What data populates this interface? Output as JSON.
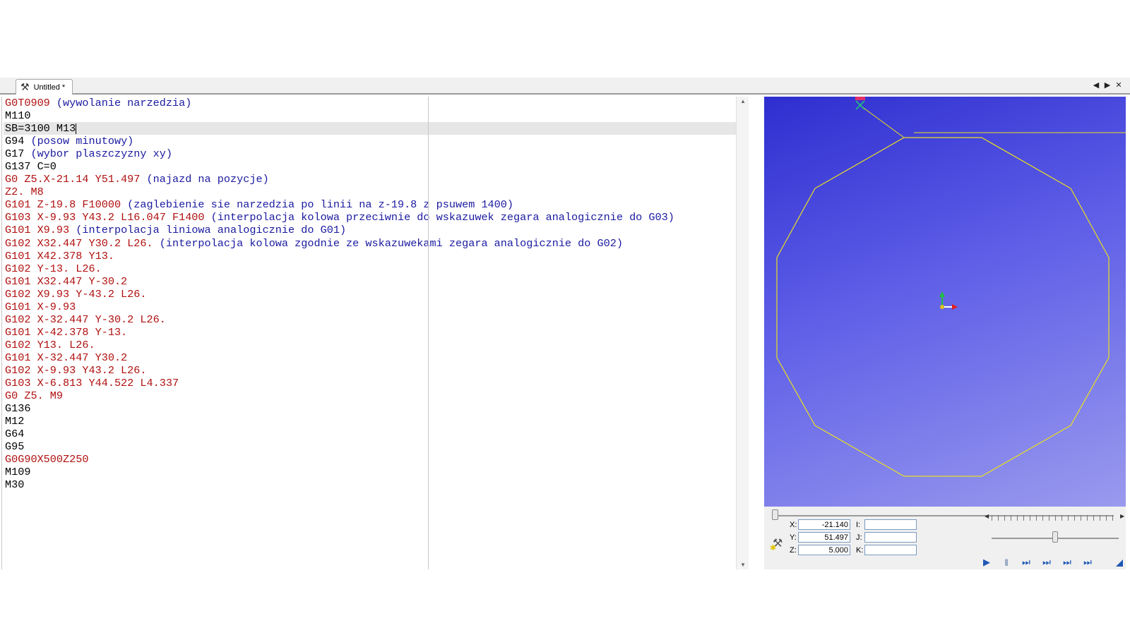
{
  "tab": {
    "title": "Untitled *",
    "icon": "tool-icon"
  },
  "tab_controls": [
    {
      "name": "prev-tab-icon",
      "glyph": "◀"
    },
    {
      "name": "next-tab-icon",
      "glyph": "▶"
    },
    {
      "name": "close-icon",
      "glyph": "✕"
    }
  ],
  "editor": {
    "lines": [
      {
        "cmd": "G0T0909 ",
        "cmt": "(wywolanie narzedzia)",
        "color": "red"
      },
      {
        "cmd": "M110",
        "cmt": "",
        "color": "black"
      },
      {
        "cmd": "SB=3100 M13",
        "cmt": "",
        "color": "black",
        "current": true
      },
      {
        "cmd": "G94 ",
        "cmt": "(posow minutowy)",
        "color": "black"
      },
      {
        "cmd": "G17 ",
        "cmt": "(wybor plaszczyzny xy)",
        "color": "black"
      },
      {
        "cmd": "G137 C=0",
        "cmt": "",
        "color": "black"
      },
      {
        "cmd": "G0 Z5.X-21.14 Y51.497 ",
        "cmt": "(najazd na pozycje)",
        "color": "red"
      },
      {
        "cmd": "Z2. M8",
        "cmt": "",
        "color": "red"
      },
      {
        "cmd": "G101 Z-19.8 F10000 ",
        "cmt": "(zaglebienie sie narzedzia po linii na z-19.8 z psuwem 1400)",
        "color": "red"
      },
      {
        "cmd": "G103 X-9.93 Y43.2 L16.047 F1400 ",
        "cmt": "(interpolacja kolowa przeciwnie do wskazuwek zegara analogicznie do G03)",
        "color": "red"
      },
      {
        "cmd": "G101 X9.93 ",
        "cmt": "(interpolacja liniowa analogicznie do G01)",
        "color": "red"
      },
      {
        "cmd": "G102 X32.447 Y30.2 L26. ",
        "cmt": "(interpolacja kolowa zgodnie ze wskazuwekami zegara analogicznie do G02)",
        "color": "red"
      },
      {
        "cmd": "G101 X42.378 Y13.",
        "cmt": "",
        "color": "red"
      },
      {
        "cmd": "G102 Y-13. L26.",
        "cmt": "",
        "color": "red"
      },
      {
        "cmd": "G101 X32.447 Y-30.2",
        "cmt": "",
        "color": "red"
      },
      {
        "cmd": "G102 X9.93 Y-43.2 L26.",
        "cmt": "",
        "color": "red"
      },
      {
        "cmd": "G101 X-9.93",
        "cmt": "",
        "color": "red"
      },
      {
        "cmd": "G102 X-32.447 Y-30.2 L26.",
        "cmt": "",
        "color": "red"
      },
      {
        "cmd": "G101 X-42.378 Y-13.",
        "cmt": "",
        "color": "red"
      },
      {
        "cmd": "G102 Y13. L26.",
        "cmt": "",
        "color": "red"
      },
      {
        "cmd": "G101 X-32.447 Y30.2",
        "cmt": "",
        "color": "red"
      },
      {
        "cmd": "G102 X-9.93 Y43.2 L26.",
        "cmt": "",
        "color": "red"
      },
      {
        "cmd": "G103 X-6.813 Y44.522 L4.337",
        "cmt": "",
        "color": "red"
      },
      {
        "cmd": "G0 Z5. M9",
        "cmt": "",
        "color": "red"
      },
      {
        "cmd": "G136",
        "cmt": "",
        "color": "black"
      },
      {
        "cmd": "M12",
        "cmt": "",
        "color": "black"
      },
      {
        "cmd": "G64",
        "cmt": "",
        "color": "black"
      },
      {
        "cmd": "G95",
        "cmt": "",
        "color": "black"
      },
      {
        "cmd": "G0G90X500Z250",
        "cmt": "",
        "color": "red"
      },
      {
        "cmd": "M109",
        "cmt": "",
        "color": "black"
      },
      {
        "cmd": "M30",
        "cmt": "",
        "color": "black"
      }
    ]
  },
  "coords": {
    "x_label": "X:",
    "x_value": "-21.140",
    "y_label": "Y:",
    "y_value": "51.497",
    "z_label": "Z:",
    "z_value": "5.000",
    "i_label": "I:",
    "i_value": "",
    "j_label": "J:",
    "j_value": "",
    "k_label": "K:",
    "k_value": ""
  },
  "simulation": {
    "progress": 0,
    "speed_fraction": 0.5,
    "buttons": [
      {
        "name": "play-button",
        "glyph": "▶"
      },
      {
        "name": "pause-button",
        "glyph": "‖"
      },
      {
        "name": "step-button",
        "glyph": "⏭"
      },
      {
        "name": "step-xy-button",
        "glyph": "⏭"
      },
      {
        "name": "step-z-button",
        "glyph": "⏭"
      },
      {
        "name": "step-tool-button",
        "glyph": "⏭"
      }
    ]
  },
  "colors": {
    "code_red": "#b01010",
    "comment_blue": "#1a1aa0",
    "toolpath_yellow": "#e8e020",
    "viewport_top": "#2e2ed0",
    "viewport_bottom": "#9a9aee"
  }
}
